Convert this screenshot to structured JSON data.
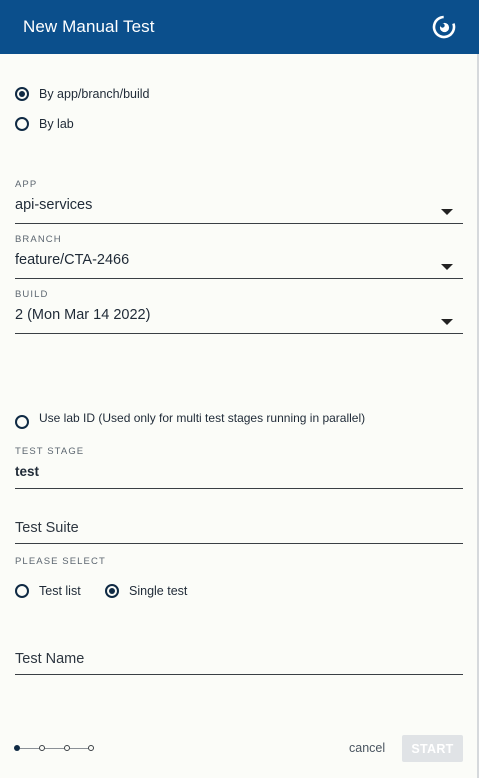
{
  "header": {
    "title": "New Manual Test",
    "logo_icon": "circular-swirl-logo"
  },
  "source_mode": {
    "options": [
      {
        "label": "By app/branch/build",
        "selected": true
      },
      {
        "label": "By lab",
        "selected": false
      }
    ]
  },
  "app": {
    "caption": "APP",
    "value": "api-services"
  },
  "branch": {
    "caption": "BRANCH",
    "value": "feature/CTA-2466"
  },
  "build": {
    "caption": "BUILD",
    "value": "2 (Mon Mar 14 2022)"
  },
  "lab_id": {
    "label": "Use lab ID (Used only for multi test stages running in parallel)",
    "selected": false
  },
  "test_stage": {
    "caption": "TEST STAGE",
    "value": "test"
  },
  "test_suite": {
    "placeholder": "Test Suite"
  },
  "selection": {
    "caption": "PLEASE SELECT",
    "options": [
      {
        "label": "Test list",
        "selected": false
      },
      {
        "label": "Single test",
        "selected": true
      }
    ]
  },
  "test_name": {
    "placeholder": "Test Name"
  },
  "stepper": {
    "total_steps": 4,
    "current_step": 1
  },
  "actions": {
    "cancel_label": "cancel",
    "start_label": "START",
    "start_enabled": false
  },
  "colors": {
    "header_bg": "#0b4f8c",
    "radio": "#0f2a44",
    "disabled_button": "#e0e3e6"
  }
}
